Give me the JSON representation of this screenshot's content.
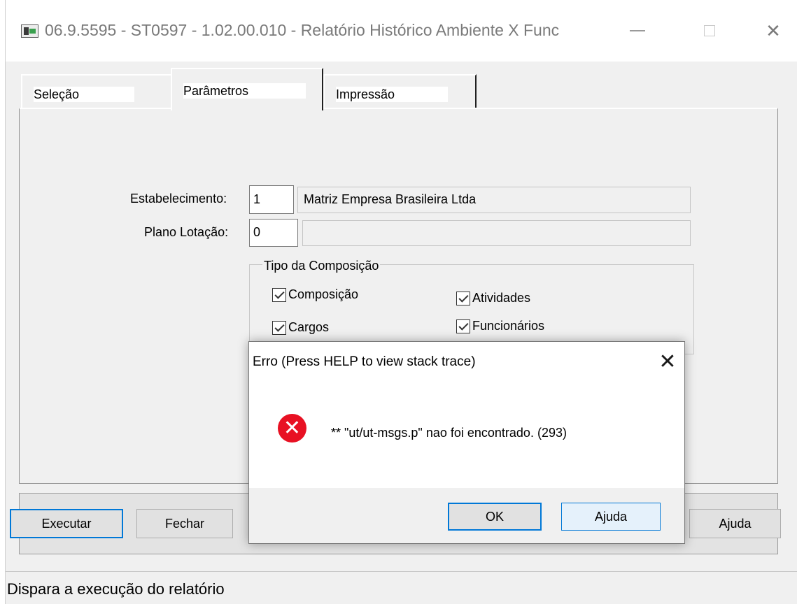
{
  "window": {
    "title": "06.9.5595 - ST0597 - 1.02.00.010 - Relatório Histórico Ambiente X Func",
    "close_glyph": "✕"
  },
  "tabs": [
    {
      "label": "Seleção"
    },
    {
      "label": "Parâmetros"
    },
    {
      "label": "Impressão"
    }
  ],
  "form": {
    "estabelecimento_label": "Estabelecimento:",
    "estabelecimento_value": "1",
    "estabelecimento_desc": "Matriz Empresa Brasileira Ltda",
    "plano_label": "Plano Lotação:",
    "plano_value": "0",
    "plano_desc": "",
    "group_title": "Tipo da Composição",
    "checks": [
      {
        "label": "Composição",
        "checked": true
      },
      {
        "label": "Atividades",
        "checked": true
      },
      {
        "label": "Cargos",
        "checked": true
      },
      {
        "label": "Funcionários",
        "checked": true
      }
    ]
  },
  "buttons": {
    "executar": "Executar",
    "fechar": "Fechar",
    "ajuda": "Ajuda"
  },
  "status_bar": "Dispara a execução do relatório",
  "dialog": {
    "title": "Erro (Press HELP to view stack trace)",
    "close_glyph": "✕",
    "icon_glyph": "✕",
    "message": "** \"ut/ut-msgs.p\" nao foi encontrado. (293)",
    "ok": "OK",
    "ajuda": "Ajuda",
    "icon_color": "#e81123"
  },
  "colors": {
    "focus_border": "#0078d7",
    "panel_bg": "#f0f0f0"
  }
}
